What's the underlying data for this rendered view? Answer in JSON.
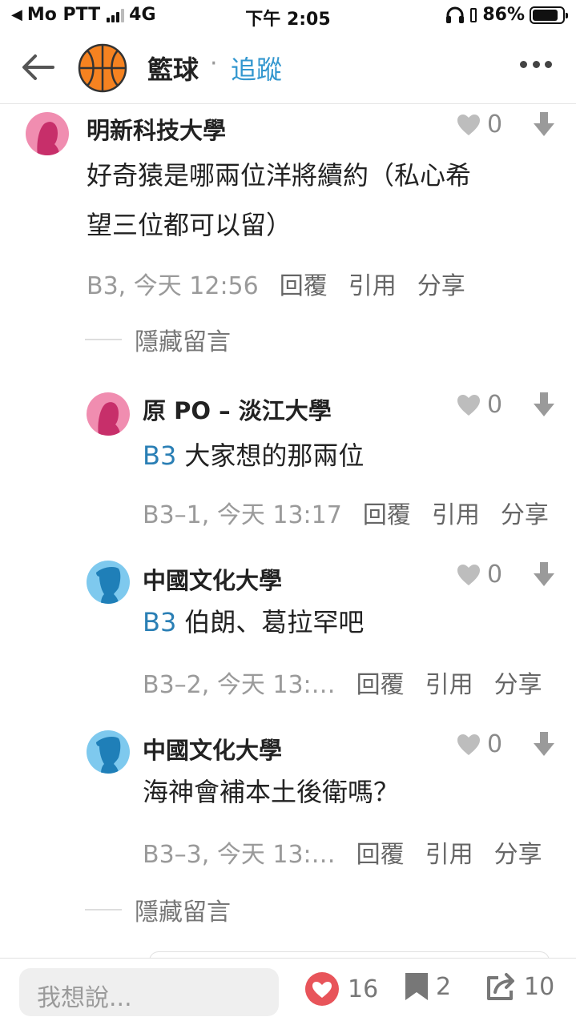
{
  "status_bar": {
    "carrier": "Mo PTT",
    "network": "4G",
    "time": "下午 2:05",
    "battery": "86%",
    "battery_level": 0.86
  },
  "header": {
    "board_name": "籃球",
    "separator": "·",
    "follow_label": "追蹤",
    "icons": [
      "back-arrow-icon",
      "basketball-icon",
      "more-icon"
    ]
  },
  "comments": [
    {
      "author": "明新科技大學",
      "avatar": "female-pink",
      "likes": "0",
      "body_line1": "好奇猿是哪兩位洋將續約（私心希",
      "body_line2": "望三位都可以留）",
      "meta": "B3, 今天 12:56",
      "actions": [
        "回覆",
        "引用",
        "分享"
      ]
    },
    {
      "author": "原 PO – 淡江大學",
      "avatar": "female-pink",
      "likes": "0",
      "ref": "B3",
      "body": "大家想的那兩位",
      "meta": "B3–1, 今天 13:17",
      "actions": [
        "回覆",
        "引用",
        "分享"
      ]
    },
    {
      "author": "中國文化大學",
      "avatar": "male-blue",
      "likes": "0",
      "ref": "B3",
      "body": "伯朗、葛拉罕吧",
      "meta": "B3–2, 今天 13:…",
      "actions": [
        "回覆",
        "引用",
        "分享"
      ]
    },
    {
      "author": "中國文化大學",
      "avatar": "male-blue",
      "likes": "0",
      "body": "海神會補本土後衛嗎？",
      "meta": "B3–3, 今天 13:…",
      "actions": [
        "回覆",
        "引用",
        "分享"
      ]
    }
  ],
  "hide_comments_label": "隱藏留言",
  "bottom_bar": {
    "input_placeholder": "我想說...",
    "likes": "16",
    "bookmarks": "2",
    "shares": "10"
  },
  "colors": {
    "accent": "#3397cf",
    "ref_blue": "#2a7fb5",
    "heart_red": "#e8545a",
    "avatar_pink": "#f08db0",
    "avatar_blue": "#7ec9ee",
    "ball_orange": "#f58220"
  }
}
